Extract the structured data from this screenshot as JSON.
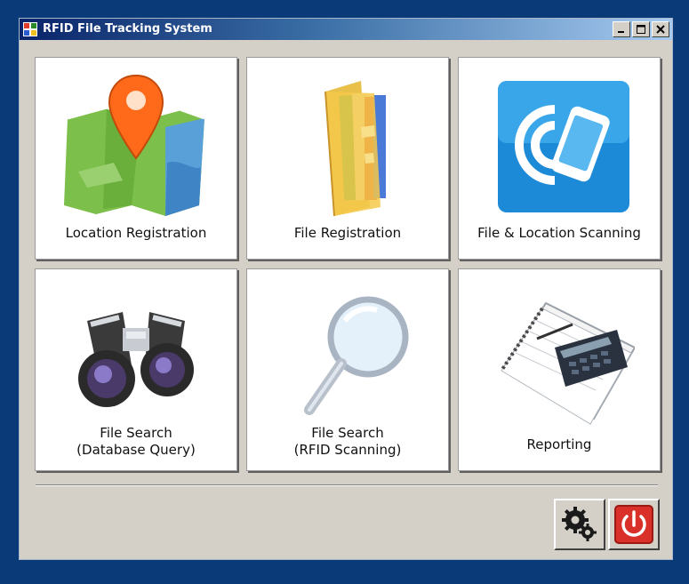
{
  "window": {
    "title": "RFID File Tracking System",
    "controls": [
      "minimize",
      "maximize",
      "close"
    ]
  },
  "tiles": [
    {
      "label": "Location Registration",
      "icon": "map-pin-icon"
    },
    {
      "label": "File Registration",
      "icon": "folder-files-icon"
    },
    {
      "label": "File & Location Scanning",
      "icon": "rfid-scan-icon"
    },
    {
      "label_line1": "File Search",
      "label_line2": "(Database Query)",
      "icon": "binoculars-icon"
    },
    {
      "label_line1": "File Search",
      "label_line2": "(RFID Scanning)",
      "icon": "magnifier-icon"
    },
    {
      "label": "Reporting",
      "icon": "report-calculator-icon"
    }
  ],
  "footer": {
    "settings_icon": "gears-icon",
    "exit_icon": "power-icon"
  },
  "colors": {
    "desktop": "#0a3a78",
    "window_bg": "#d4d0c8",
    "titlebar_start": "#0a246a",
    "titlebar_end": "#a6caf0",
    "power_red": "#d9302a"
  }
}
